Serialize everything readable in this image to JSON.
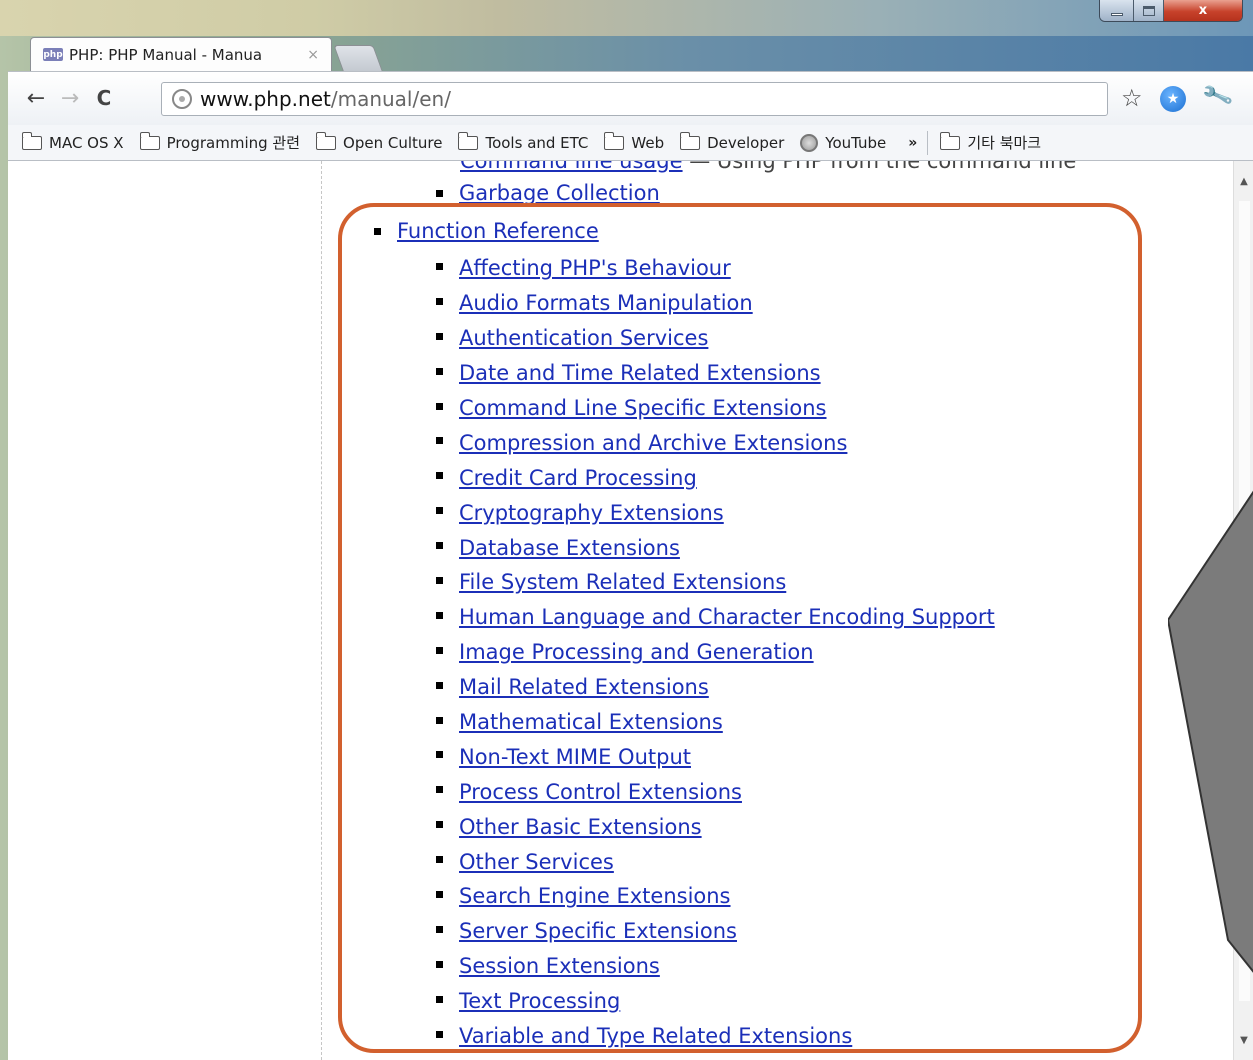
{
  "window": {
    "close_glyph": "x"
  },
  "tab": {
    "favicon_text": "php",
    "title": "PHP: PHP Manual - Manua",
    "close_glyph": "×"
  },
  "toolbar": {
    "url_host": "www.php.net",
    "url_path": "/manual/en/",
    "back_glyph": "←",
    "forward_glyph": "→",
    "reload_glyph": "C",
    "star_glyph": "☆",
    "wrench_glyph": "🔧"
  },
  "bookmarks": {
    "items": [
      {
        "label": "MAC OS X",
        "icon": "folder-icon"
      },
      {
        "label": "Programming 관련",
        "icon": "folder-icon"
      },
      {
        "label": "Open Culture",
        "icon": "folder-icon"
      },
      {
        "label": "Tools and ETC",
        "icon": "folder-icon"
      },
      {
        "label": "Web",
        "icon": "folder-icon"
      },
      {
        "label": "Developer",
        "icon": "folder-icon"
      },
      {
        "label": "YouTube",
        "icon": "globe-icon"
      }
    ],
    "overflow_glyph": "»",
    "other_label": "기타 북마크"
  },
  "content": {
    "cut_link": "Command line usage",
    "cut_text": " — Using PHP from the command line",
    "garbage_collection": "Garbage Collection",
    "function_reference": "Function Reference",
    "sub_items": [
      "Affecting PHP's Behaviour",
      "Audio Formats Manipulation",
      "Authentication Services",
      "Date and Time Related Extensions",
      "Command Line Specific Extensions",
      "Compression and Archive Extensions",
      "Credit Card Processing",
      "Cryptography Extensions",
      "Database Extensions",
      "File System Related Extensions",
      "Human Language and Character Encoding Support",
      "Image Processing and Generation",
      "Mail Related Extensions",
      "Mathematical Extensions",
      "Non-Text MIME Output",
      "Process Control Extensions",
      "Other Basic Extensions",
      "Other Services",
      "Search Engine Extensions",
      "Server Specific Extensions",
      "Session Extensions",
      "Text Processing",
      "Variable and Type Related Extensions"
    ]
  },
  "colors": {
    "link": "#1b2fb8",
    "highlight": "#d2602e",
    "cursor_fill": "#7b7b7b"
  }
}
